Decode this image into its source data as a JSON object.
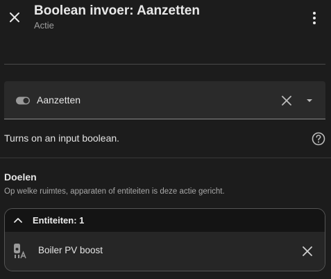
{
  "header": {
    "title": "Boolean invoer: Aanzetten",
    "subtitle": "Actie",
    "close_icon": "close-icon",
    "menu_icon": "dots-vertical-icon"
  },
  "action_field": {
    "value": "Aanzetten",
    "icon": "toggle-switch-icon",
    "clear_icon": "close-icon",
    "dropdown_icon": "menu-down-icon"
  },
  "description": {
    "text": "Turns on an input boolean.",
    "help_icon": "help-circle-icon"
  },
  "targets": {
    "heading": "Doelen",
    "help_text": "Op welke ruimtes, apparaten of entiteiten is deze actie gericht.",
    "entities_group": {
      "title": "Entiteiten: 1",
      "expanded": true,
      "items": [
        {
          "name": "Boiler PV boost",
          "icon": "water-boiler-auto-icon"
        }
      ]
    }
  },
  "colors": {
    "background": "#1c1c1c",
    "field_background": "#2a2a2a",
    "text_primary": "#e1e1e1",
    "text_secondary": "#9e9e9e",
    "border": "#555555"
  }
}
